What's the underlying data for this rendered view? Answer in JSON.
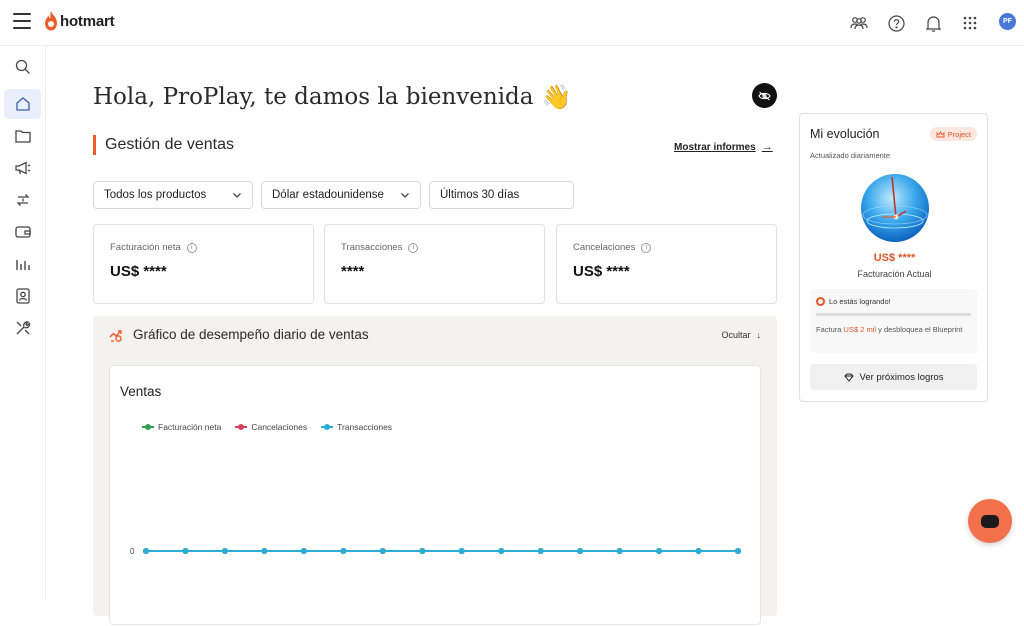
{
  "brand": {
    "name": "hotmart",
    "accent": "#ef5b2a"
  },
  "topbar": {
    "icons": [
      "users-icon",
      "help-icon",
      "bell-icon",
      "apps-grid-icon"
    ],
    "avatar_initials": "PF"
  },
  "sidebar": {
    "items": [
      {
        "icon": "search-icon",
        "active": false
      },
      {
        "icon": "home-icon",
        "active": true
      },
      {
        "icon": "folder-icon",
        "active": false
      },
      {
        "icon": "megaphone-icon",
        "active": false
      },
      {
        "icon": "transfer-icon",
        "active": false
      },
      {
        "icon": "wallet-icon",
        "active": false
      },
      {
        "icon": "bar-chart-icon",
        "active": false
      },
      {
        "icon": "contact-card-icon",
        "active": false
      },
      {
        "icon": "tools-icon",
        "active": false
      }
    ]
  },
  "main": {
    "greeting": "Hola, ProPlay, te damos la bienvenida",
    "greeting_emoji": "👋",
    "section_title": "Gestión de ventas",
    "report_link": "Mostrar informes",
    "filters": {
      "product": "Todos los productos",
      "currency": "Dólar estadounidense",
      "period": "Últimos 30 días"
    },
    "kpis": [
      {
        "label": "Facturación neta",
        "value": "US$ ****"
      },
      {
        "label": "Transacciones",
        "value": "****"
      },
      {
        "label": "Cancelaciones",
        "value": "US$ ****"
      }
    ],
    "chart_section": {
      "title": "Gráfico de desempeño diario de ventas",
      "hide_label": "Ocultar",
      "card_title": "Ventas"
    }
  },
  "chart_data": {
    "type": "line",
    "title": "Ventas",
    "xlabel": "",
    "ylabel": "",
    "y_ticks": [
      "0"
    ],
    "legend_position": "top-left",
    "series": [
      {
        "name": "Facturación neta",
        "color": "#2e9e4f",
        "values": [
          0,
          0,
          0,
          0,
          0,
          0,
          0,
          0,
          0,
          0,
          0,
          0,
          0,
          0,
          0,
          0,
          0,
          0,
          0,
          0,
          0,
          0,
          0,
          0,
          0,
          0,
          0,
          0,
          0,
          0,
          0
        ]
      },
      {
        "name": "Cancelaciones",
        "color": "#d6415f",
        "values": [
          0,
          0,
          0,
          0,
          0,
          0,
          0,
          0,
          0,
          0,
          0,
          0,
          0,
          0,
          0,
          0,
          0,
          0,
          0,
          0,
          0,
          0,
          0,
          0,
          0,
          0,
          0,
          0,
          0,
          0,
          0
        ]
      },
      {
        "name": "Transacciones",
        "color": "#2aaed6",
        "values": [
          0,
          0,
          0,
          0,
          0,
          0,
          0,
          0,
          0,
          0,
          0,
          0,
          0,
          0,
          0,
          0,
          0,
          0,
          0,
          0,
          0,
          0,
          0,
          0,
          0,
          0,
          0,
          0,
          0,
          0,
          0
        ]
      }
    ]
  },
  "evolution": {
    "title": "Mi evolución",
    "badge": "Project",
    "subtitle": "Actualizado diariamente",
    "amount": "US$ ****",
    "amount_label": "Facturación Actual",
    "progress_title": "Lo estás logrando!",
    "progress_value": 0,
    "desc_prefix": "Factura",
    "desc_highlight": "US$ 2 mil",
    "desc_suffix": "y desbloquea el Blueprint",
    "button": "Ver próximos logros"
  }
}
